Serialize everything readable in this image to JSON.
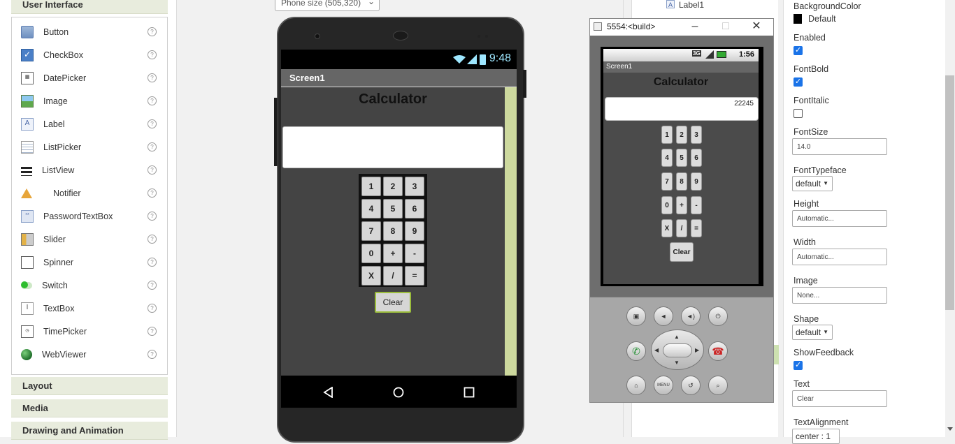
{
  "palette": {
    "user_interface_header": "User Interface",
    "components": [
      {
        "label": "Button",
        "icon": "button-icon"
      },
      {
        "label": "CheckBox",
        "icon": "checkbox-icon"
      },
      {
        "label": "DatePicker",
        "icon": "datepicker-icon"
      },
      {
        "label": "Image",
        "icon": "image-icon"
      },
      {
        "label": "Label",
        "icon": "label-icon"
      },
      {
        "label": "ListPicker",
        "icon": "listpicker-icon"
      },
      {
        "label": "ListView",
        "icon": "listview-icon"
      },
      {
        "label": "Notifier",
        "icon": "notifier-icon"
      },
      {
        "label": "PasswordTextBox",
        "icon": "password-textbox-icon"
      },
      {
        "label": "Slider",
        "icon": "slider-icon"
      },
      {
        "label": "Spinner",
        "icon": "spinner-icon"
      },
      {
        "label": "Switch",
        "icon": "switch-icon"
      },
      {
        "label": "TextBox",
        "icon": "textbox-icon"
      },
      {
        "label": "TimePicker",
        "icon": "timepicker-icon"
      },
      {
        "label": "WebViewer",
        "icon": "webviewer-icon"
      }
    ],
    "help_glyph": "?",
    "categories": [
      "Layout",
      "Media",
      "Drawing and Animation"
    ]
  },
  "viewer": {
    "size_select": "Phone size (505,320)",
    "status_time": "9:48",
    "screen_title": "Screen1",
    "app_title": "Calculator",
    "keys": [
      "1",
      "2",
      "3",
      "4",
      "5",
      "6",
      "7",
      "8",
      "9",
      "0",
      "+",
      "-",
      "X",
      "/",
      "="
    ],
    "clear_label": "Clear"
  },
  "emulator": {
    "window_title": "5554:<build>",
    "status_time": "1:56",
    "network": "3G",
    "screen_title": "Screen1",
    "app_title": "Calculator",
    "display_value": "22245",
    "keys": [
      "1",
      "2",
      "3",
      "4",
      "5",
      "6",
      "7",
      "8",
      "9",
      "0",
      "+",
      "-",
      "X",
      "/",
      "="
    ],
    "clear_label": "Clear",
    "menu_label": "MENU"
  },
  "tree": {
    "label1": "Label1"
  },
  "properties": {
    "background_color_label": "BackgroundColor",
    "background_color_value": "Default",
    "enabled_label": "Enabled",
    "fontbold_label": "FontBold",
    "fontitalic_label": "FontItalic",
    "fontsize_label": "FontSize",
    "fontsize_value": "14.0",
    "fonttypeface_label": "FontTypeface",
    "fonttypeface_value": "default",
    "height_label": "Height",
    "height_value": "Automatic...",
    "width_label": "Width",
    "width_value": "Automatic...",
    "image_label": "Image",
    "image_value": "None...",
    "shape_label": "Shape",
    "shape_value": "default",
    "showfeedback_label": "ShowFeedback",
    "text_label": "Text",
    "text_value": "Clear",
    "textalignment_label": "TextAlignment",
    "textalignment_value": "center : 1"
  },
  "colors": {
    "accent_green": "#9bbd3c",
    "checkbox_blue": "#1a73e8"
  }
}
